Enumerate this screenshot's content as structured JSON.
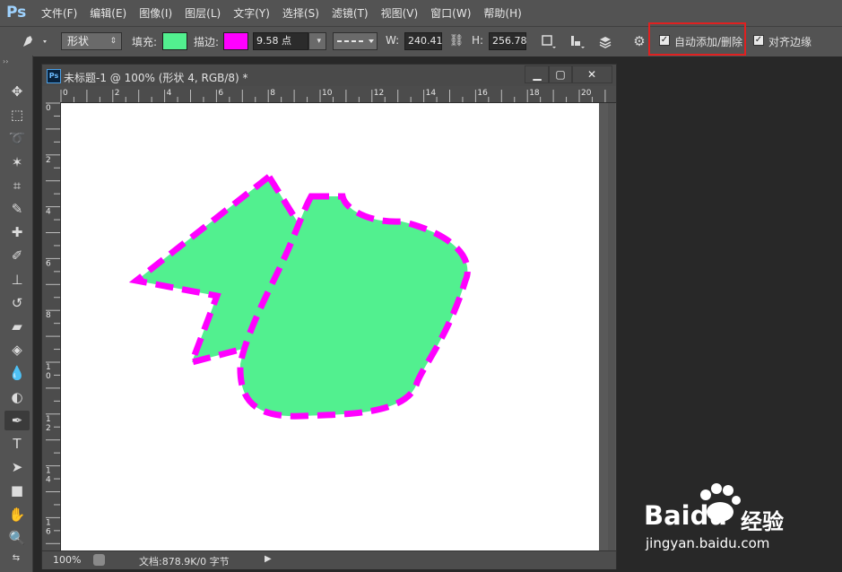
{
  "app": {
    "logo": "Ps"
  },
  "menu": {
    "items": [
      "文件(F)",
      "编辑(E)",
      "图像(I)",
      "图层(L)",
      "文字(Y)",
      "选择(S)",
      "滤镜(T)",
      "视图(V)",
      "窗口(W)",
      "帮助(H)"
    ]
  },
  "options": {
    "tool_icon": "pen-tool-icon",
    "mode": "形状",
    "fill_label": "填充:",
    "fill_color": "#52f08f",
    "stroke_label": "描边:",
    "stroke_color": "#ff00ff",
    "stroke_width": "9.58 点",
    "stroke_type": "dashed-line",
    "w_label": "W:",
    "w_value": "240.41",
    "h_label": "H:",
    "h_value": "256.78",
    "auto_add_delete": {
      "label": "自动添加/删除",
      "checked": true
    },
    "align_edges": {
      "label": "对齐边缘",
      "checked": true
    }
  },
  "tools": [
    "move-tool-icon",
    "marquee-tool-icon",
    "lasso-tool-icon",
    "magic-wand-tool-icon",
    "crop-tool-icon",
    "eyedropper-tool-icon",
    "healing-brush-tool-icon",
    "brush-tool-icon",
    "clone-stamp-tool-icon",
    "history-brush-tool-icon",
    "eraser-tool-icon",
    "paint-bucket-tool-icon",
    "blur-tool-icon",
    "dodge-tool-icon",
    "pen-tool-icon",
    "type-tool-icon",
    "path-selection-tool-icon",
    "rectangle-tool-icon",
    "hand-tool-icon",
    "zoom-tool-icon"
  ],
  "active_tool": "pen-tool-icon",
  "document": {
    "title": "未标题-1 @ 100% (形状 4, RGB/8) *",
    "ruler_h_labels": [
      "0",
      "2",
      "4",
      "6",
      "8",
      "10",
      "12",
      "14",
      "16",
      "18",
      "20"
    ],
    "ruler_v_labels": [
      "0",
      "2",
      "4",
      "6",
      "8",
      "10",
      "12",
      "14",
      "16"
    ],
    "zoom": "100%",
    "doc_info": "文档:878.9K/0 字节"
  },
  "shapes": {
    "fill": "#52f08f",
    "stroke": "#ff00ff"
  },
  "watermark": {
    "brand": "Baidu",
    "suffix": "经验",
    "url": "jingyan.baidu.com"
  }
}
